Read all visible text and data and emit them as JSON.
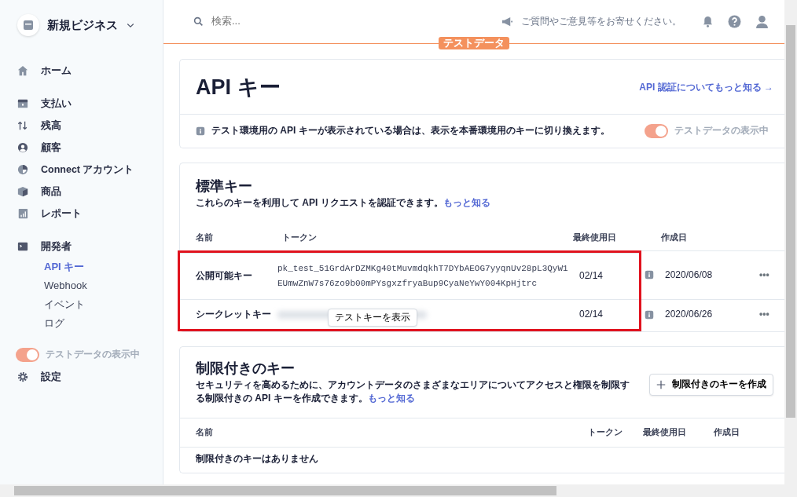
{
  "account": {
    "name": "新規ビジネス"
  },
  "sidebar": {
    "items": [
      {
        "label": "ホーム",
        "selected": false
      },
      {
        "label": "支払い",
        "selected": false
      },
      {
        "label": "残高",
        "selected": false
      },
      {
        "label": "顧客",
        "selected": false
      },
      {
        "label": "Connect アカウント",
        "selected": false
      },
      {
        "label": "商品",
        "selected": false
      },
      {
        "label": "レポート",
        "selected": false
      },
      {
        "label": "開発者",
        "selected": false,
        "children": [
          {
            "label": "API キー",
            "selected": true
          },
          {
            "label": "Webhook",
            "selected": false
          },
          {
            "label": "イベント",
            "selected": false
          },
          {
            "label": "ログ",
            "selected": false
          }
        ]
      }
    ],
    "test_toggle": {
      "label": "テストデータの表示中",
      "on": true
    },
    "settings": {
      "label": "設定"
    }
  },
  "header": {
    "search_placeholder": "検索...",
    "feedback": "ご質問やご意見等をお寄せください。",
    "test_badge": "テストデータ"
  },
  "api_card": {
    "title": "API キー",
    "link": "API 認証についてもっと知る →",
    "notice": "テスト環境用の API キーが表示されている場合は、表示を本番環境用のキーに切り換えます。",
    "toggle": {
      "label": "テストデータの表示中",
      "on": true
    }
  },
  "standard_keys": {
    "title": "標準キー",
    "description": "これらのキーを利用して API リクエストを認証できます。",
    "link": "もっと知る",
    "columns": [
      "名前",
      "トークン",
      "最終使用日",
      "作成日"
    ],
    "rows": [
      {
        "name": "公開可能キー",
        "token": "pk_test_51GrdArDZMKg40tMuvmdqkhT7DYbAEOG7yyqnUv28pL3QyW1EUmwZnW7s76zo9b00mPYsgxzfryaBup9CyaNeYwY004KpHjtrc",
        "masked": false,
        "last_used": "02/14",
        "created": "2020/06/08",
        "more": "•••"
      },
      {
        "name": "シークレットキー",
        "reveal_button": "テストキーを表示",
        "masked": true,
        "last_used": "02/14",
        "created": "2020/06/26",
        "more": "•••"
      }
    ]
  },
  "restricted_keys": {
    "title": "制限付きのキー",
    "description": "セキュリティを高めるために、アカウントデータのさまざまなエリアについてアクセスと権限を制限する制限付きの API キーを作成できます。",
    "link": "もっと知る",
    "create_button": "制限付きのキーを作成",
    "columns": [
      "名前",
      "トークン",
      "最終使用日",
      "作成日"
    ],
    "empty": "制限付きのキーはありません"
  }
}
